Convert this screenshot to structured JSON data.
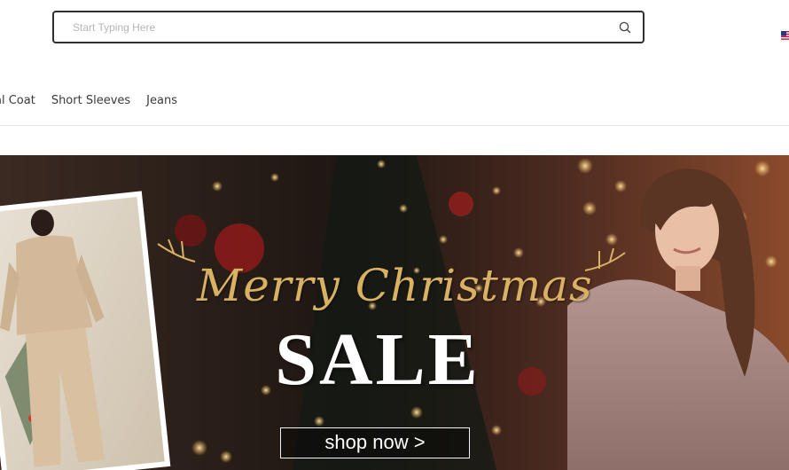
{
  "search": {
    "placeholder": "Start Typing Here"
  },
  "nav": {
    "items": [
      {
        "label": "al Coat"
      },
      {
        "label": "Short Sleeves"
      },
      {
        "label": "Jeans"
      }
    ]
  },
  "banner": {
    "headline_script": "Merry Christmas",
    "headline_main": "SALE",
    "cta_label": "shop now >"
  },
  "colors": {
    "accent_gold": "#d8b262",
    "search_border": "#2f2f2f",
    "divider": "#e3e3e3"
  },
  "icons": {
    "search": "search-icon",
    "flag": "us-flag-icon"
  }
}
